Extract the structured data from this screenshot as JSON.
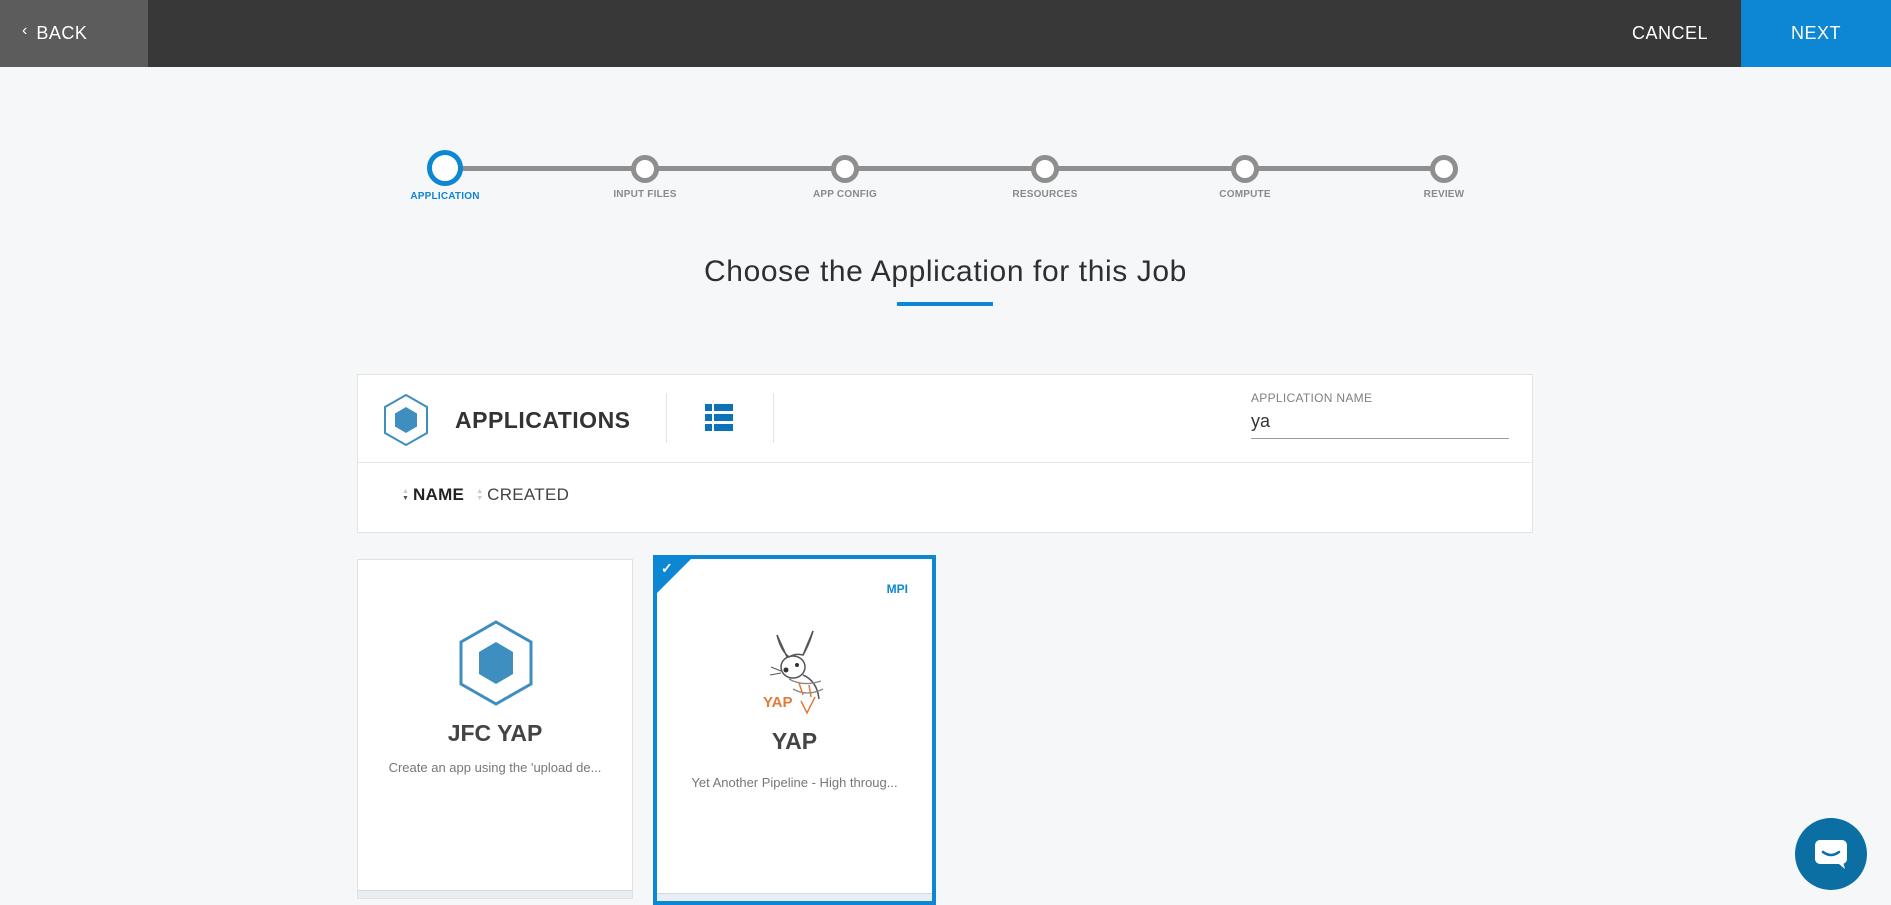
{
  "toolbar": {
    "back_label": "BACK",
    "cancel_label": "CANCEL",
    "next_label": "NEXT"
  },
  "stepper": {
    "steps": [
      {
        "label": "APPLICATION",
        "active": true
      },
      {
        "label": "INPUT FILES",
        "active": false
      },
      {
        "label": "APP CONFIG",
        "active": false
      },
      {
        "label": "RESOURCES",
        "active": false
      },
      {
        "label": "COMPUTE",
        "active": false
      },
      {
        "label": "REVIEW",
        "active": false
      }
    ]
  },
  "page": {
    "title": "Choose the Application for this Job"
  },
  "applications_panel": {
    "title": "APPLICATIONS",
    "view_icon": "list-view-icon",
    "search": {
      "label": "APPLICATION NAME",
      "value": "ya"
    },
    "sort": {
      "name_label": "NAME",
      "created_label": "CREATED",
      "active": "NAME"
    }
  },
  "cards": [
    {
      "title": "JFC YAP",
      "description": "Create an app using the 'upload de...",
      "icon": "hexagon-app-icon",
      "selected": false
    },
    {
      "title": "YAP",
      "description": "Yet Another Pipeline - High throug...",
      "icon": "yap-logo",
      "logo_text": "YAP",
      "badge": "MPI",
      "selected": true
    }
  ],
  "colors": {
    "accent": "#0d86d4",
    "topbar": "#383838",
    "back_button": "#5c5c5c",
    "background": "#f6f7f8"
  },
  "chat": {
    "icon": "chat-icon"
  }
}
